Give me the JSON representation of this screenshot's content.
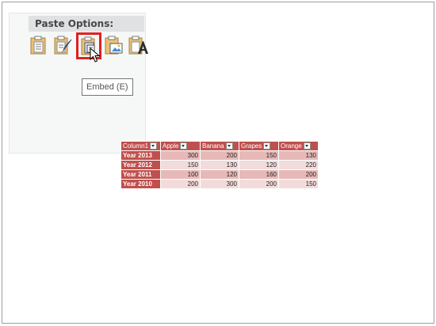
{
  "paste_options": {
    "title": "Paste Options:",
    "icons": [
      {
        "name": "clipboard-paste-icon"
      },
      {
        "name": "clipboard-brush-icon"
      },
      {
        "name": "embed-clipboard-icon"
      },
      {
        "name": "picture-clipboard-icon"
      },
      {
        "name": "text-clipboard-icon"
      }
    ],
    "tooltip": "Embed (E)"
  },
  "colors": {
    "table_header": "#c0504d",
    "band_odd": "#e6b9b8",
    "band_even": "#f2dcdb",
    "selection_outline": "#e02020"
  },
  "table": {
    "columns": [
      "Column1",
      "Apple",
      "Banana",
      "Grapes",
      "Orange"
    ],
    "rows": [
      {
        "label": "Year 2013",
        "values": [
          "300",
          "200",
          "150",
          "130"
        ]
      },
      {
        "label": "Year 2012",
        "values": [
          "150",
          "130",
          "120",
          "220"
        ]
      },
      {
        "label": "Year 2011",
        "values": [
          "100",
          "120",
          "160",
          "200"
        ]
      },
      {
        "label": "Year 2010",
        "values": [
          "200",
          "300",
          "200",
          "150"
        ]
      }
    ]
  }
}
